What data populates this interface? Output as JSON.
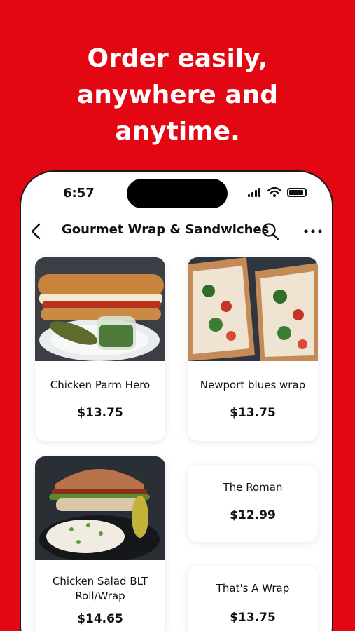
{
  "promo": {
    "line1": "Order easily,",
    "line2": "anywhere and",
    "line3": "anytime."
  },
  "status_bar": {
    "time": "6:57"
  },
  "nav": {
    "title": "Gourmet Wrap & Sandwiches",
    "back_icon": "chevron-left-icon",
    "search_icon": "search-icon",
    "more_icon": "more-horizontal-icon"
  },
  "colors": {
    "brand": "#e30613"
  },
  "items": [
    {
      "name": "Chicken Parm Hero",
      "price": "$13.75"
    },
    {
      "name": "Newport blues wrap",
      "price": "$13.75"
    },
    {
      "name": "Chicken Salad BLT Roll/Wrap",
      "price": "$14.65"
    },
    {
      "name": "The Roman",
      "price": "$12.99"
    },
    {
      "name": "That's A Wrap",
      "price": "$13.75"
    }
  ]
}
